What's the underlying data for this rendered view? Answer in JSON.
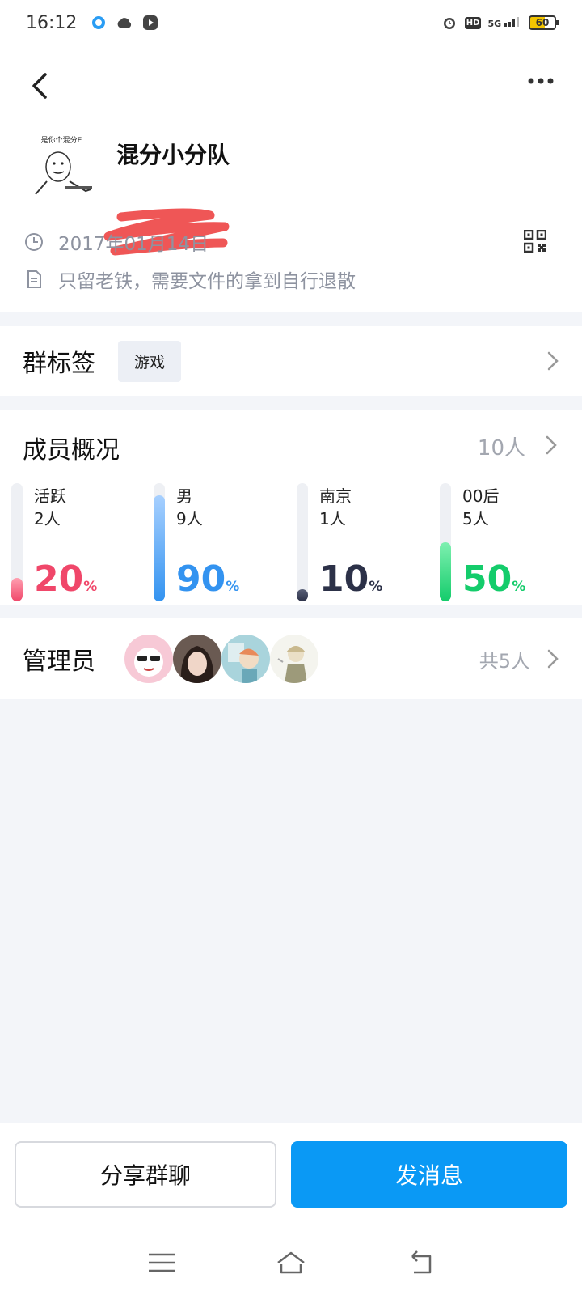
{
  "status_bar": {
    "time": "16:12",
    "network": "5G",
    "hd": "HD",
    "battery": "60"
  },
  "group": {
    "name": "混分小分队",
    "avatar_caption": "是你个混分E",
    "created_date": "2017年01月14日",
    "description": "只留老铁，需要文件的拿到自行退散"
  },
  "tags": {
    "title": "群标签",
    "items": [
      "游戏"
    ]
  },
  "members": {
    "title": "成员概况",
    "count": "10人",
    "stats": [
      {
        "label": "活跃",
        "count": "2人",
        "percent": 20,
        "percent_text": "20",
        "color": "#f0476a",
        "fill_top": "#ff9fb0"
      },
      {
        "label": "男",
        "count": "9人",
        "percent": 90,
        "percent_text": "90",
        "color": "#3393f0",
        "fill_top": "#a7d0ff"
      },
      {
        "label": "南京",
        "count": "1人",
        "percent": 10,
        "percent_text": "10",
        "color": "#2c3148",
        "fill_top": "#5a6078"
      },
      {
        "label": "00后",
        "count": "5人",
        "percent": 50,
        "percent_text": "50",
        "color": "#14cc6b",
        "fill_top": "#7ef0b0"
      }
    ],
    "percent_sign": "%"
  },
  "admins": {
    "title": "管理员",
    "count": "共5人"
  },
  "actions": {
    "share_label": "分享群聊",
    "send_label": "发消息"
  },
  "colors": {
    "accent": "#0a99f5",
    "muted": "#a3a7b0"
  }
}
